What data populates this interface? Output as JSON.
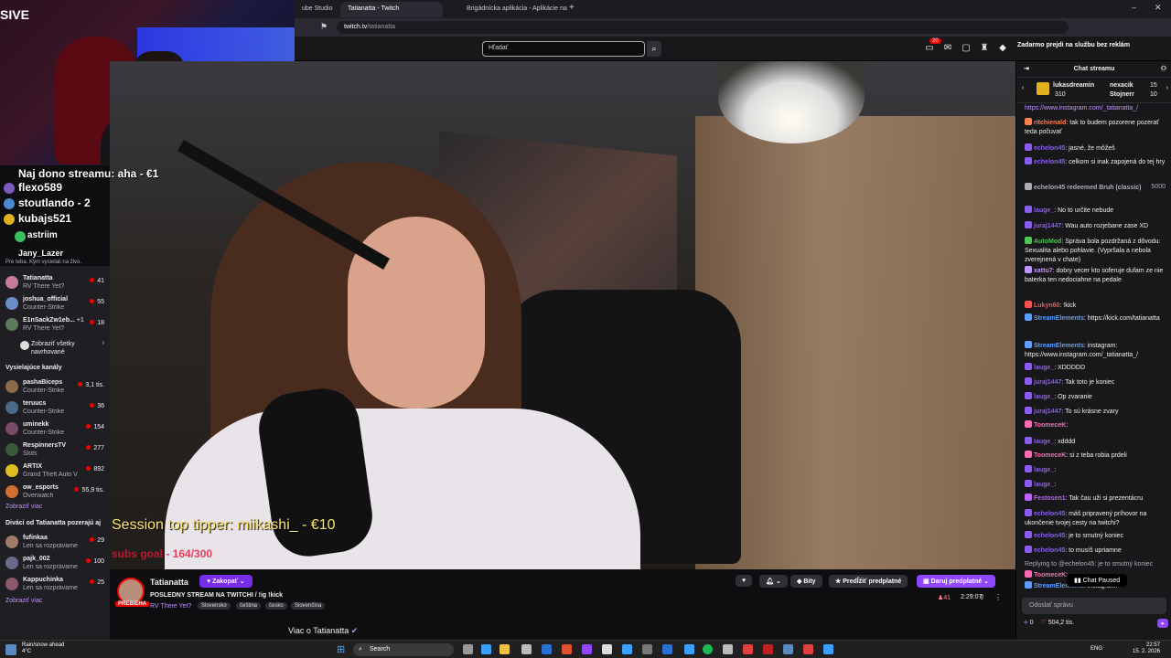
{
  "browser": {
    "tabs": [
      {
        "label": "ube Studio"
      },
      {
        "label": "Tatianatta - Twitch",
        "active": true
      },
      {
        "label": "Brigádnícka aplikácia - Aplikácie na"
      }
    ],
    "url_host": "twitch.tv",
    "url_path": "/tatianatta"
  },
  "webcam_tag": "SIVE",
  "topnav": {
    "search_placeholder": "Hľadať",
    "notif_count": "20",
    "prime_label": "Zadarmo prejdi na službu bez reklám"
  },
  "overlay": {
    "top_donation": "Naj dono streamu: aha - €1",
    "lines": [
      "flexo589",
      "stoutlando - 2",
      "kubajs521",
      "astriim",
      "Jany_Lazer"
    ]
  },
  "sidebar": {
    "recommend_caption": "Pre teba. Kým vysielali na živo.",
    "followed": [
      {
        "name": "Tatianatta",
        "game": "RV There Yet?",
        "viewers": "41",
        "color": "#c87a9a"
      },
      {
        "name": "joshua_official",
        "game": "Counter-Strike",
        "viewers": "55",
        "color": "#6a8ec8"
      },
      {
        "name": "E1nSackZw1eb...",
        "game": "RV There Yet?",
        "viewers": "18",
        "extra": "+1",
        "color": "#5a7a5a"
      }
    ],
    "show_all": "Zobraziť všetky navrhované",
    "live_heading": "Vysielajúce kanály",
    "live": [
      {
        "name": "pashaBiceps",
        "game": "Counter-Strike",
        "viewers": "3,1 tis.",
        "color": "#8a6a4a"
      },
      {
        "name": "teruucs",
        "game": "Counter-Strike",
        "viewers": "36",
        "color": "#4a6a8a"
      },
      {
        "name": "uminekk",
        "game": "Counter-Strike",
        "viewers": "154",
        "color": "#7a4a6a"
      },
      {
        "name": "RespinnersTV",
        "game": "Slots",
        "viewers": "277",
        "color": "#3a5a3a"
      },
      {
        "name": "ARTIX",
        "game": "Grand Theft Auto V",
        "viewers": "892",
        "color": "#e0c020"
      },
      {
        "name": "ow_esports",
        "game": "Overwatch",
        "viewers": "55,9 tis.",
        "color": "#d07030"
      }
    ],
    "show_more": "Zobraziť viac",
    "also_heading": "Diváci od Tatianatta pozerajú aj",
    "also": [
      {
        "name": "fufinkaa",
        "game": "Len sa rozprávame",
        "viewers": "29",
        "color": "#a07a6a"
      },
      {
        "name": "pajk_002",
        "game": "Len sa rozprávame",
        "viewers": "100",
        "color": "#6a6a8a"
      },
      {
        "name": "Kappuchinka",
        "game": "Len sa rozprávame",
        "viewers": "25",
        "color": "#8a5a6a"
      }
    ],
    "show_more2": "Zobraziť viac"
  },
  "video": {
    "tipper": "Session top tipper: miikashi_ - €10",
    "subgoal": "subs goal - 164/300"
  },
  "info": {
    "live_badge": "PREBIEHA",
    "streamer": "Tatianatta",
    "follow": "Zakopať",
    "title": "POSLEDNY STREAM NA TWITCHI / !ig !kick",
    "game": "RV There Yet?",
    "tags": [
      "Slovensko",
      "čeština",
      "česko",
      "Slovenčina"
    ],
    "bits": "Bity",
    "renew": "Predĺžiť predplatné",
    "gift": "Daruj predplatné",
    "viewers": "41",
    "uptime": "2:29:07",
    "about": "Viac o Tatianatta"
  },
  "chat": {
    "title": "Chat streamu",
    "gifters": [
      {
        "name": "lukasdreamin",
        "count": "310"
      },
      {
        "name": "nexacik",
        "count": "15"
      },
      {
        "name": "Stojnerr",
        "count": "10"
      }
    ],
    "messages": [
      {
        "user": "",
        "text": "https://www.instagram.com/_tatianatta_/",
        "color": "#bf94ff"
      },
      {
        "user": "ritchienald",
        "text": ": tak to budem pozorene pozerať teda počuvať",
        "color": "#ff7f50"
      },
      {
        "user": "echelon45",
        "text": ": jasné, že môžeš",
        "color": "#8a5cf6"
      },
      {
        "user": "echelon45",
        "text": ": celkom si inak zapojená do tej hry",
        "color": "#8a5cf6"
      },
      {
        "user": "echelon45 redeemed Bruh (classic)",
        "text": "",
        "color": "#adadb8",
        "points": "5000"
      },
      {
        "user": "lauge_",
        "text": ": No to určite nebude",
        "color": "#8a5cf6"
      },
      {
        "user": "juraj1447",
        "text": ": Wau auto rozjebane zase XD",
        "color": "#8a5cf6"
      },
      {
        "user": "AutoMod",
        "text": ": Správa bola pozdržaná z dôvodu: Sexualita alebo pohlavie. (Vypršala a nebola zverejnená v chate)",
        "color": "#4dc552"
      },
      {
        "user": "xattu7",
        "text": ": dobry vecer kto soferuje dufam ze nie baterka ten nedociahne na pedale",
        "color": "#bf94ff"
      },
      {
        "user": "Lukyn60",
        "text": ": !kick",
        "color": "#ff4f4f"
      },
      {
        "user": "StreamElements",
        "text": ": https://kick.com/tatianatta",
        "color": "#5c9fff"
      },
      {
        "user": "StreamElements",
        "text": ": instagram: https://www.instagram.com/_tatianatta_/",
        "color": "#5c9fff"
      },
      {
        "user": "lauge_",
        "text": ": XDDDDD",
        "color": "#8a5cf6"
      },
      {
        "user": "juraj1447",
        "text": ": Tak toto je koniec",
        "color": "#8a5cf6"
      },
      {
        "user": "lauge_",
        "text": ": Op zvaranie",
        "color": "#8a5cf6"
      },
      {
        "user": "juraj1447",
        "text": ": To sú krásne zvary",
        "color": "#8a5cf6"
      },
      {
        "user": "ToomeceK",
        "text": ":",
        "color": "#ff69b4"
      },
      {
        "user": "lauge_",
        "text": ": xdddd",
        "color": "#8a5cf6"
      },
      {
        "user": "ToomeceK",
        "text": ": si z teba robia prdeli",
        "color": "#ff69b4"
      },
      {
        "user": "lauge_",
        "text": ":",
        "color": "#8a5cf6"
      },
      {
        "user": "lauge_",
        "text": ":",
        "color": "#8a5cf6"
      },
      {
        "user": "Festosen1",
        "text": ": Tak čau uži si prezentácru",
        "color": "#c060ff"
      },
      {
        "user": "echelon45",
        "text": ": máš pripravený príhovor na ukončenie tvojej cesty na twitchi?",
        "color": "#8a5cf6"
      },
      {
        "user": "echelon45",
        "text": ": je to smutný koniec",
        "color": "#8a5cf6"
      },
      {
        "user": "echelon45",
        "text": ": to musíš upriamne",
        "color": "#8a5cf6"
      },
      {
        "user": "",
        "text": "Replying to @echelon45: je to smutný koniec",
        "color": "#adadb8"
      },
      {
        "user": "ToomeceK",
        "text": ":",
        "color": "#ff69b4"
      },
      {
        "user": "StreamElements",
        "text": ": instagram:",
        "color": "#5c9fff"
      }
    ],
    "paused": "Chat Paused",
    "input_placeholder": "Odoslať správu",
    "points": "0",
    "points2": "504,2 tis."
  },
  "taskbar": {
    "weather1": "Rain/snow ahead",
    "weather2": "4°C",
    "search": "Search",
    "lang": "ENG",
    "time": "22:57",
    "date": "15. 2. 2026"
  }
}
